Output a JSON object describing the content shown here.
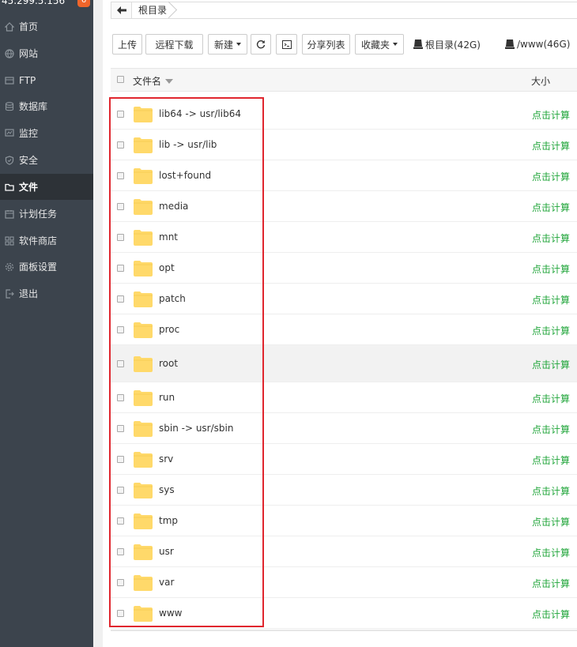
{
  "sidebar": {
    "ip": "45.299.5.156",
    "badge": "6",
    "items": [
      {
        "label": "首页",
        "icon": "home-icon"
      },
      {
        "label": "网站",
        "icon": "globe-icon"
      },
      {
        "label": "FTP",
        "icon": "ftp-icon"
      },
      {
        "label": "数据库",
        "icon": "database-icon"
      },
      {
        "label": "监控",
        "icon": "monitor-icon"
      },
      {
        "label": "安全",
        "icon": "shield-icon"
      },
      {
        "label": "文件",
        "icon": "folder-icon"
      },
      {
        "label": "计划任务",
        "icon": "calendar-icon"
      },
      {
        "label": "软件商店",
        "icon": "apps-icon"
      },
      {
        "label": "面板设置",
        "icon": "gear-icon"
      },
      {
        "label": "退出",
        "icon": "logout-icon"
      }
    ],
    "active_index": 6
  },
  "breadcrumb": {
    "root": "根目录"
  },
  "toolbar": {
    "upload": "上传",
    "remote_download": "远程下载",
    "new": "新建",
    "share_list": "分享列表",
    "favorites": "收藏夹",
    "disks": [
      {
        "label": "根目录(42G)",
        "icon": "disk-icon"
      },
      {
        "label": "/www(46G)",
        "icon": "disk-icon"
      }
    ]
  },
  "table": {
    "col_name": "文件名",
    "col_size": "大小",
    "rows": [
      {
        "name": "lib64 -> usr/lib64",
        "size": "点击计算"
      },
      {
        "name": "lib -> usr/lib",
        "size": "点击计算"
      },
      {
        "name": "lost+found",
        "size": "点击计算"
      },
      {
        "name": "media",
        "size": "点击计算"
      },
      {
        "name": "mnt",
        "size": "点击计算"
      },
      {
        "name": "opt",
        "size": "点击计算"
      },
      {
        "name": "patch",
        "size": "点击计算"
      },
      {
        "name": "proc",
        "size": "点击计算"
      },
      {
        "name": "root",
        "size": "点击计算"
      },
      {
        "name": "run",
        "size": "点击计算"
      },
      {
        "name": "sbin -> usr/sbin",
        "size": "点击计算"
      },
      {
        "name": "srv",
        "size": "点击计算"
      },
      {
        "name": "sys",
        "size": "点击计算"
      },
      {
        "name": "tmp",
        "size": "点击计算"
      },
      {
        "name": "usr",
        "size": "点击计算"
      },
      {
        "name": "var",
        "size": "点击计算"
      },
      {
        "name": "www",
        "size": "点击计算"
      }
    ],
    "highlighted_index": 8
  },
  "colors": {
    "sidebar_bg": "#3c444d",
    "sidebar_active": "#2d3237",
    "accent_green": "#20a53a",
    "folder_yellow": "#ffd96a",
    "annotation_red": "#e0262e"
  }
}
